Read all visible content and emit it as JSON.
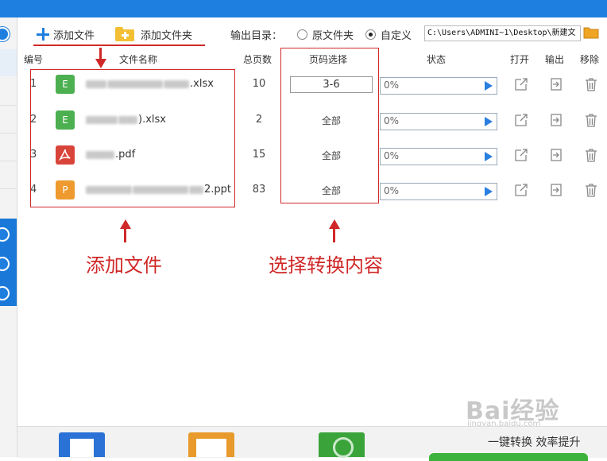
{
  "toolbar": {
    "add_file_label": "添加文件",
    "add_folder_label": "添加文件夹",
    "output_dir_label": "输出目录：",
    "option_original": "原文件夹",
    "option_custom": "自定义",
    "selected_option": "自定义",
    "output_path": "C:\\Users\\ADMINI~1\\Desktop\\新建文"
  },
  "table": {
    "headers": {
      "number": "编号",
      "filename": "文件名称",
      "total_pages": "总页数",
      "page_select": "页码选择",
      "status": "状态",
      "open": "打开",
      "output": "输出",
      "remove": "移除"
    },
    "rows": [
      {
        "num": "1",
        "icon_letter": "E",
        "icon_color": "#4caf50",
        "name_suffix": ".xlsx",
        "pages": "10",
        "range": "3-6",
        "progress": "0%"
      },
      {
        "num": "2",
        "icon_letter": "E",
        "icon_color": "#4caf50",
        "name_suffix": ").xlsx",
        "pages": "2",
        "range": "全部",
        "progress": "0%"
      },
      {
        "num": "3",
        "icon_letter": "",
        "icon_color": "#d9443a",
        "name_suffix": ".pdf",
        "pages": "15",
        "range": "全部",
        "progress": "0%"
      },
      {
        "num": "4",
        "icon_letter": "P",
        "icon_color": "#ee9a2e",
        "name_suffix": "2.ppt",
        "pages": "83",
        "range": "全部",
        "progress": "0%"
      }
    ]
  },
  "annotations": {
    "add_files": "添加文件",
    "select_content": "选择转换内容"
  },
  "footer": {
    "slogan": "一键转换  效率提升"
  },
  "watermark": {
    "brand": "Bai经验",
    "url": "jingyan.baidu.com"
  },
  "colors": {
    "accent_blue": "#1f7fe0",
    "annotation_red": "#d02828",
    "folder_yellow": "#f3c033"
  }
}
